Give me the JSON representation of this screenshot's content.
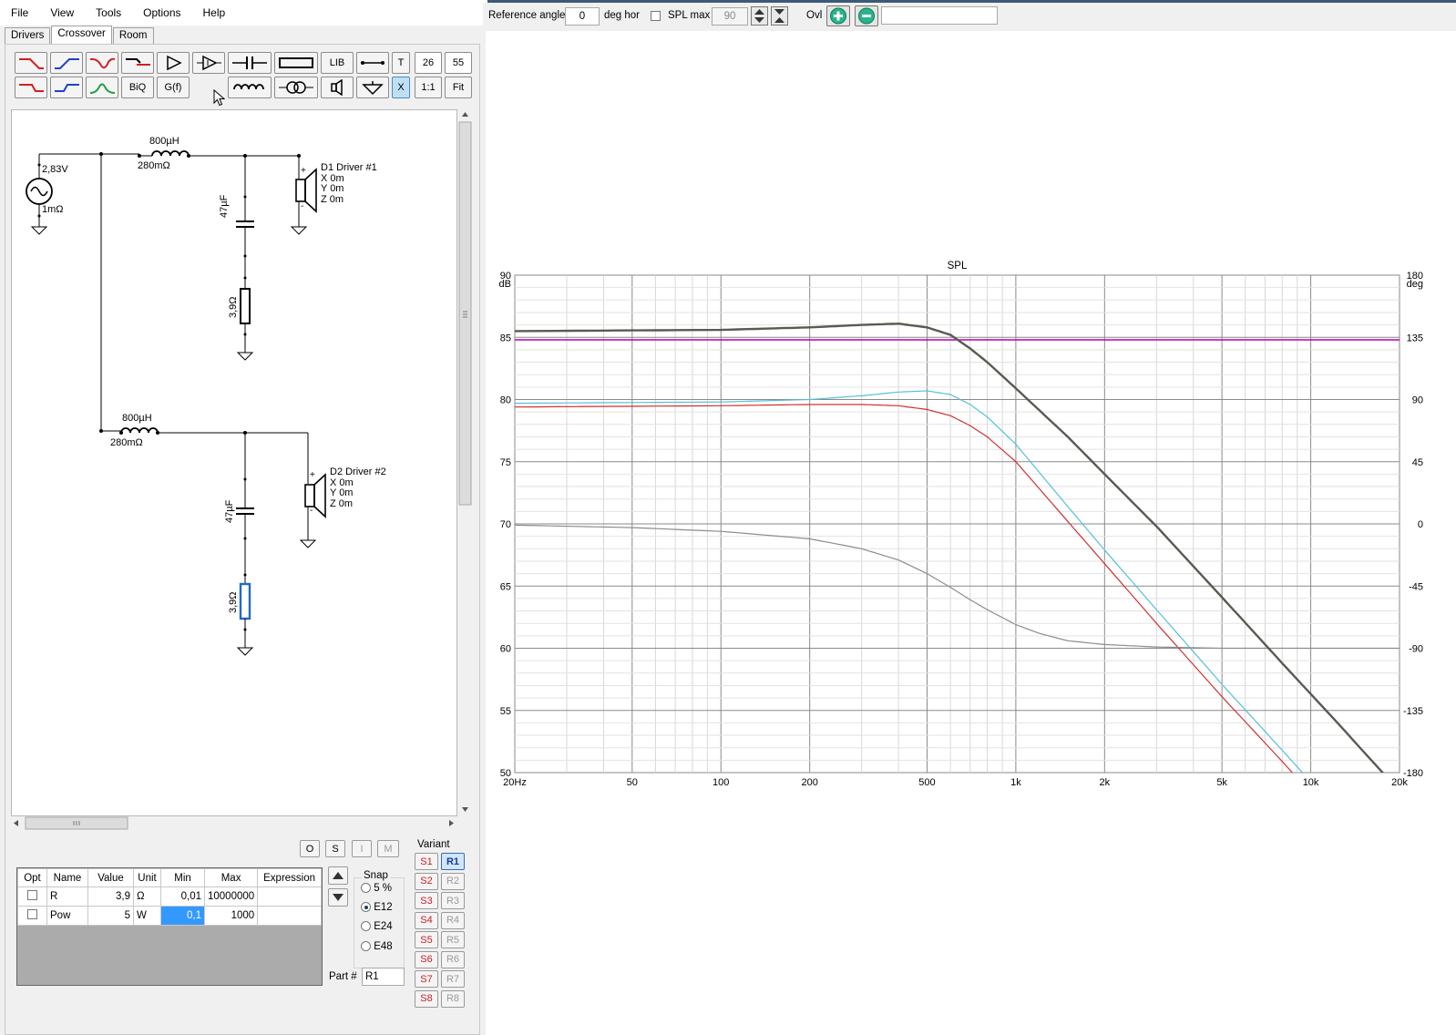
{
  "menu": [
    "File",
    "View",
    "Tools",
    "Options",
    "Help"
  ],
  "tabs": [
    {
      "label": "Drivers"
    },
    {
      "label": "Crossover",
      "active": true
    },
    {
      "label": "Room"
    }
  ],
  "toolbar": {
    "lib": "LIB",
    "t": "T",
    "val1": "26",
    "val2": "55",
    "biq": "BiQ",
    "gf": "G(f)",
    "ratio": "1:1",
    "fit": "Fit",
    "x": "X"
  },
  "schematic": {
    "source_voltage": "2,83V",
    "source_res": "1mΩ",
    "l1_value": "800µH",
    "l1_res": "280mΩ",
    "c1_value": "47µF",
    "r1_value": "3,9Ω",
    "d1_name": "D1 Driver #1",
    "d1_x": "X 0m",
    "d1_y": "Y 0m",
    "d1_z": "Z 0m",
    "l2_value": "800µH",
    "l2_res": "280mΩ",
    "c2_value": "47µF",
    "r2_value": "3,9Ω",
    "d2_name": "D2 Driver #2",
    "d2_x": "X 0m",
    "d2_y": "Y 0m",
    "d2_z": "Z 0m"
  },
  "params": {
    "headers": [
      "Opt",
      "Name",
      "Value",
      "Unit",
      "Min",
      "Max",
      "Expression"
    ],
    "rows": [
      {
        "name": "R",
        "value": "3,9",
        "unit": "Ω",
        "min": "0,01",
        "max": "10000000",
        "expr": ""
      },
      {
        "name": "Pow",
        "value": "5",
        "unit": "W",
        "min": "0,1",
        "max": "1000",
        "expr": ""
      }
    ],
    "mode_buttons": [
      "O",
      "S",
      "I",
      "M"
    ],
    "snap_label": "Snap",
    "snap_options": [
      {
        "label": "5 %",
        "on": false
      },
      {
        "label": "E12",
        "on": true
      },
      {
        "label": "E24",
        "on": false
      },
      {
        "label": "E48",
        "on": false
      }
    ],
    "part_label": "Part #",
    "part_value": "R1",
    "variant_label": "Variant",
    "variants_s": [
      "S1",
      "S2",
      "S3",
      "S4",
      "S5",
      "S6",
      "S7",
      "S8"
    ],
    "variants_r": [
      "R1",
      "R2",
      "R3",
      "R4",
      "R5",
      "R6",
      "R7",
      "R8"
    ]
  },
  "topbar": {
    "ref_angle_label": "Reference angle",
    "ref_angle_value": "0",
    "deg_hor": "deg hor",
    "spl_max_label": "SPL max",
    "spl_max_value": "90",
    "ovl": "Ovl",
    "extra_value": ""
  },
  "chart_data": {
    "type": "line",
    "title": "SPL",
    "x_scale": "log",
    "xlim": [
      20,
      20000
    ],
    "x_ticks": [
      {
        "v": 20,
        "l": "20Hz"
      },
      {
        "v": 50,
        "l": "50"
      },
      {
        "v": 100,
        "l": "100"
      },
      {
        "v": 200,
        "l": "200"
      },
      {
        "v": 500,
        "l": "500"
      },
      {
        "v": 1000,
        "l": "1k"
      },
      {
        "v": 2000,
        "l": "2k"
      },
      {
        "v": 5000,
        "l": "5k"
      },
      {
        "v": 10000,
        "l": "10k"
      },
      {
        "v": 20000,
        "l": "20k"
      }
    ],
    "ylim": [
      50,
      90
    ],
    "y_ticks": [
      50,
      55,
      60,
      65,
      70,
      75,
      80,
      85,
      90
    ],
    "ylabel": "dB",
    "y2lim": [
      -180,
      180
    ],
    "y2_ticks": [
      -180,
      -135,
      -90,
      -45,
      0,
      45,
      90,
      135,
      180
    ],
    "y2label": "deg",
    "grid": true,
    "series": [
      {
        "color": "#b400b4",
        "width": 1.6,
        "x": [
          20,
          20000
        ],
        "y": [
          84.8,
          84.8
        ]
      },
      {
        "color": "#55c0d8",
        "width": 1.2,
        "x": [
          20,
          100,
          200,
          300,
          400,
          500,
          600,
          700,
          800,
          1000,
          1500,
          2000,
          3000,
          5000,
          8000,
          12000,
          16000
        ],
        "y": [
          79.7,
          79.8,
          80.0,
          80.3,
          80.6,
          80.7,
          80.4,
          79.6,
          78.6,
          76.4,
          71.4,
          67.9,
          63.1,
          57.1,
          51.8,
          47.2,
          43.8
        ]
      },
      {
        "color": "#d03030",
        "width": 1.2,
        "x": [
          20,
          100,
          200,
          300,
          400,
          500,
          600,
          700,
          800,
          1000,
          1500,
          2000,
          3000,
          5000,
          8000,
          12000,
          16000
        ],
        "y": [
          79.4,
          79.5,
          79.6,
          79.6,
          79.5,
          79.2,
          78.7,
          77.9,
          77.0,
          75.0,
          70.2,
          66.8,
          62.0,
          56.1,
          50.9,
          46.3,
          43.0
        ]
      },
      {
        "color": "#8c8c8c",
        "width": 1.2,
        "x": [
          20,
          50,
          100,
          200,
          300,
          400,
          500,
          600,
          700,
          800,
          1000,
          1200,
          1500,
          2000,
          3000,
          5000,
          20000
        ],
        "y": [
          69.9,
          69.7,
          69.4,
          68.8,
          68.0,
          67.1,
          66.0,
          64.9,
          63.9,
          63.1,
          61.9,
          61.2,
          60.6,
          60.3,
          60.1,
          60.0,
          60.0
        ]
      },
      {
        "color": "#5a5a52",
        "width": 2.4,
        "x": [
          20,
          100,
          200,
          300,
          400,
          500,
          600,
          700,
          800,
          1000,
          1500,
          2000,
          3000,
          5000,
          8000,
          12000,
          20000
        ],
        "y": [
          85.5,
          85.6,
          85.8,
          86.0,
          86.1,
          85.8,
          85.2,
          84.1,
          83.0,
          80.9,
          77.0,
          74.0,
          69.8,
          64.1,
          58.8,
          54.3,
          48.5
        ]
      }
    ]
  }
}
